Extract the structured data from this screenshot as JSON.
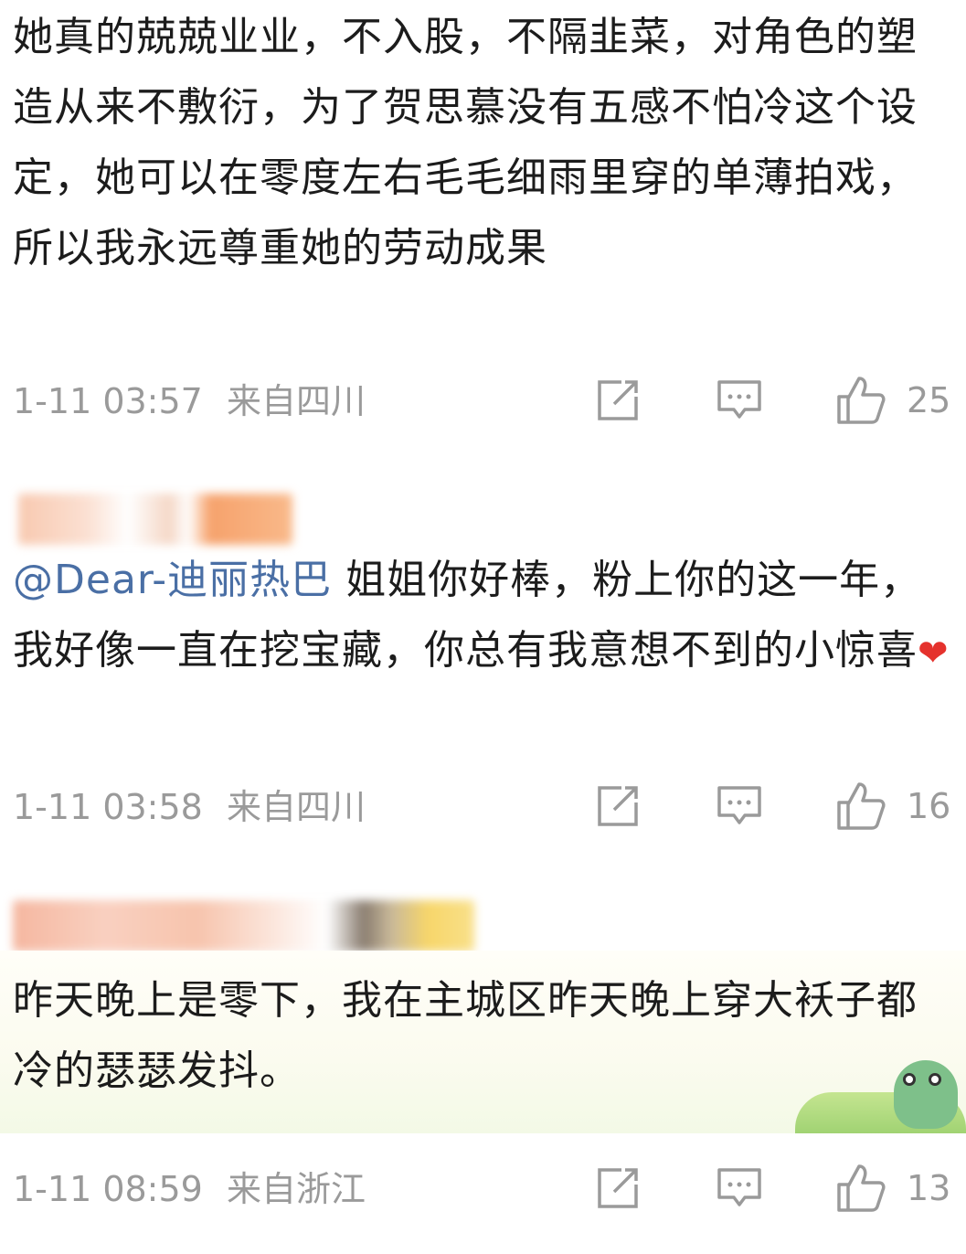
{
  "comments": [
    {
      "text": "她真的兢兢业业，不入股，不隔韭菜，对角色的塑造从来不敷衍，为了贺思慕没有五感不怕冷这个设定，她可以在零度左右毛毛细雨里穿的单薄拍戏，所以我永远尊重她的劳动成果",
      "time": "1-11 03:57",
      "location": "来自四川",
      "likes": "25"
    },
    {
      "mention": "@Dear-迪丽热巴",
      "text": " 姐姐你好棒，粉上你的这一年，我好像一直在挖宝藏，你总有我意想不到的小惊喜",
      "heart": "❤",
      "time": "1-11 03:58",
      "location": "来自四川",
      "likes": "16"
    },
    {
      "text": "昨天晚上是零下，我在主城区昨天晚上穿大袄子都冷的瑟瑟发抖。",
      "time": "1-11 08:59",
      "location": "来自浙江",
      "likes": "13"
    }
  ],
  "icons": {
    "share": "share-icon",
    "comment": "comment-icon",
    "like": "thumbs-up-icon"
  },
  "colors": {
    "text": "#1c1c1c",
    "meta": "#9a9a9a",
    "mention": "#4a6fa5"
  }
}
